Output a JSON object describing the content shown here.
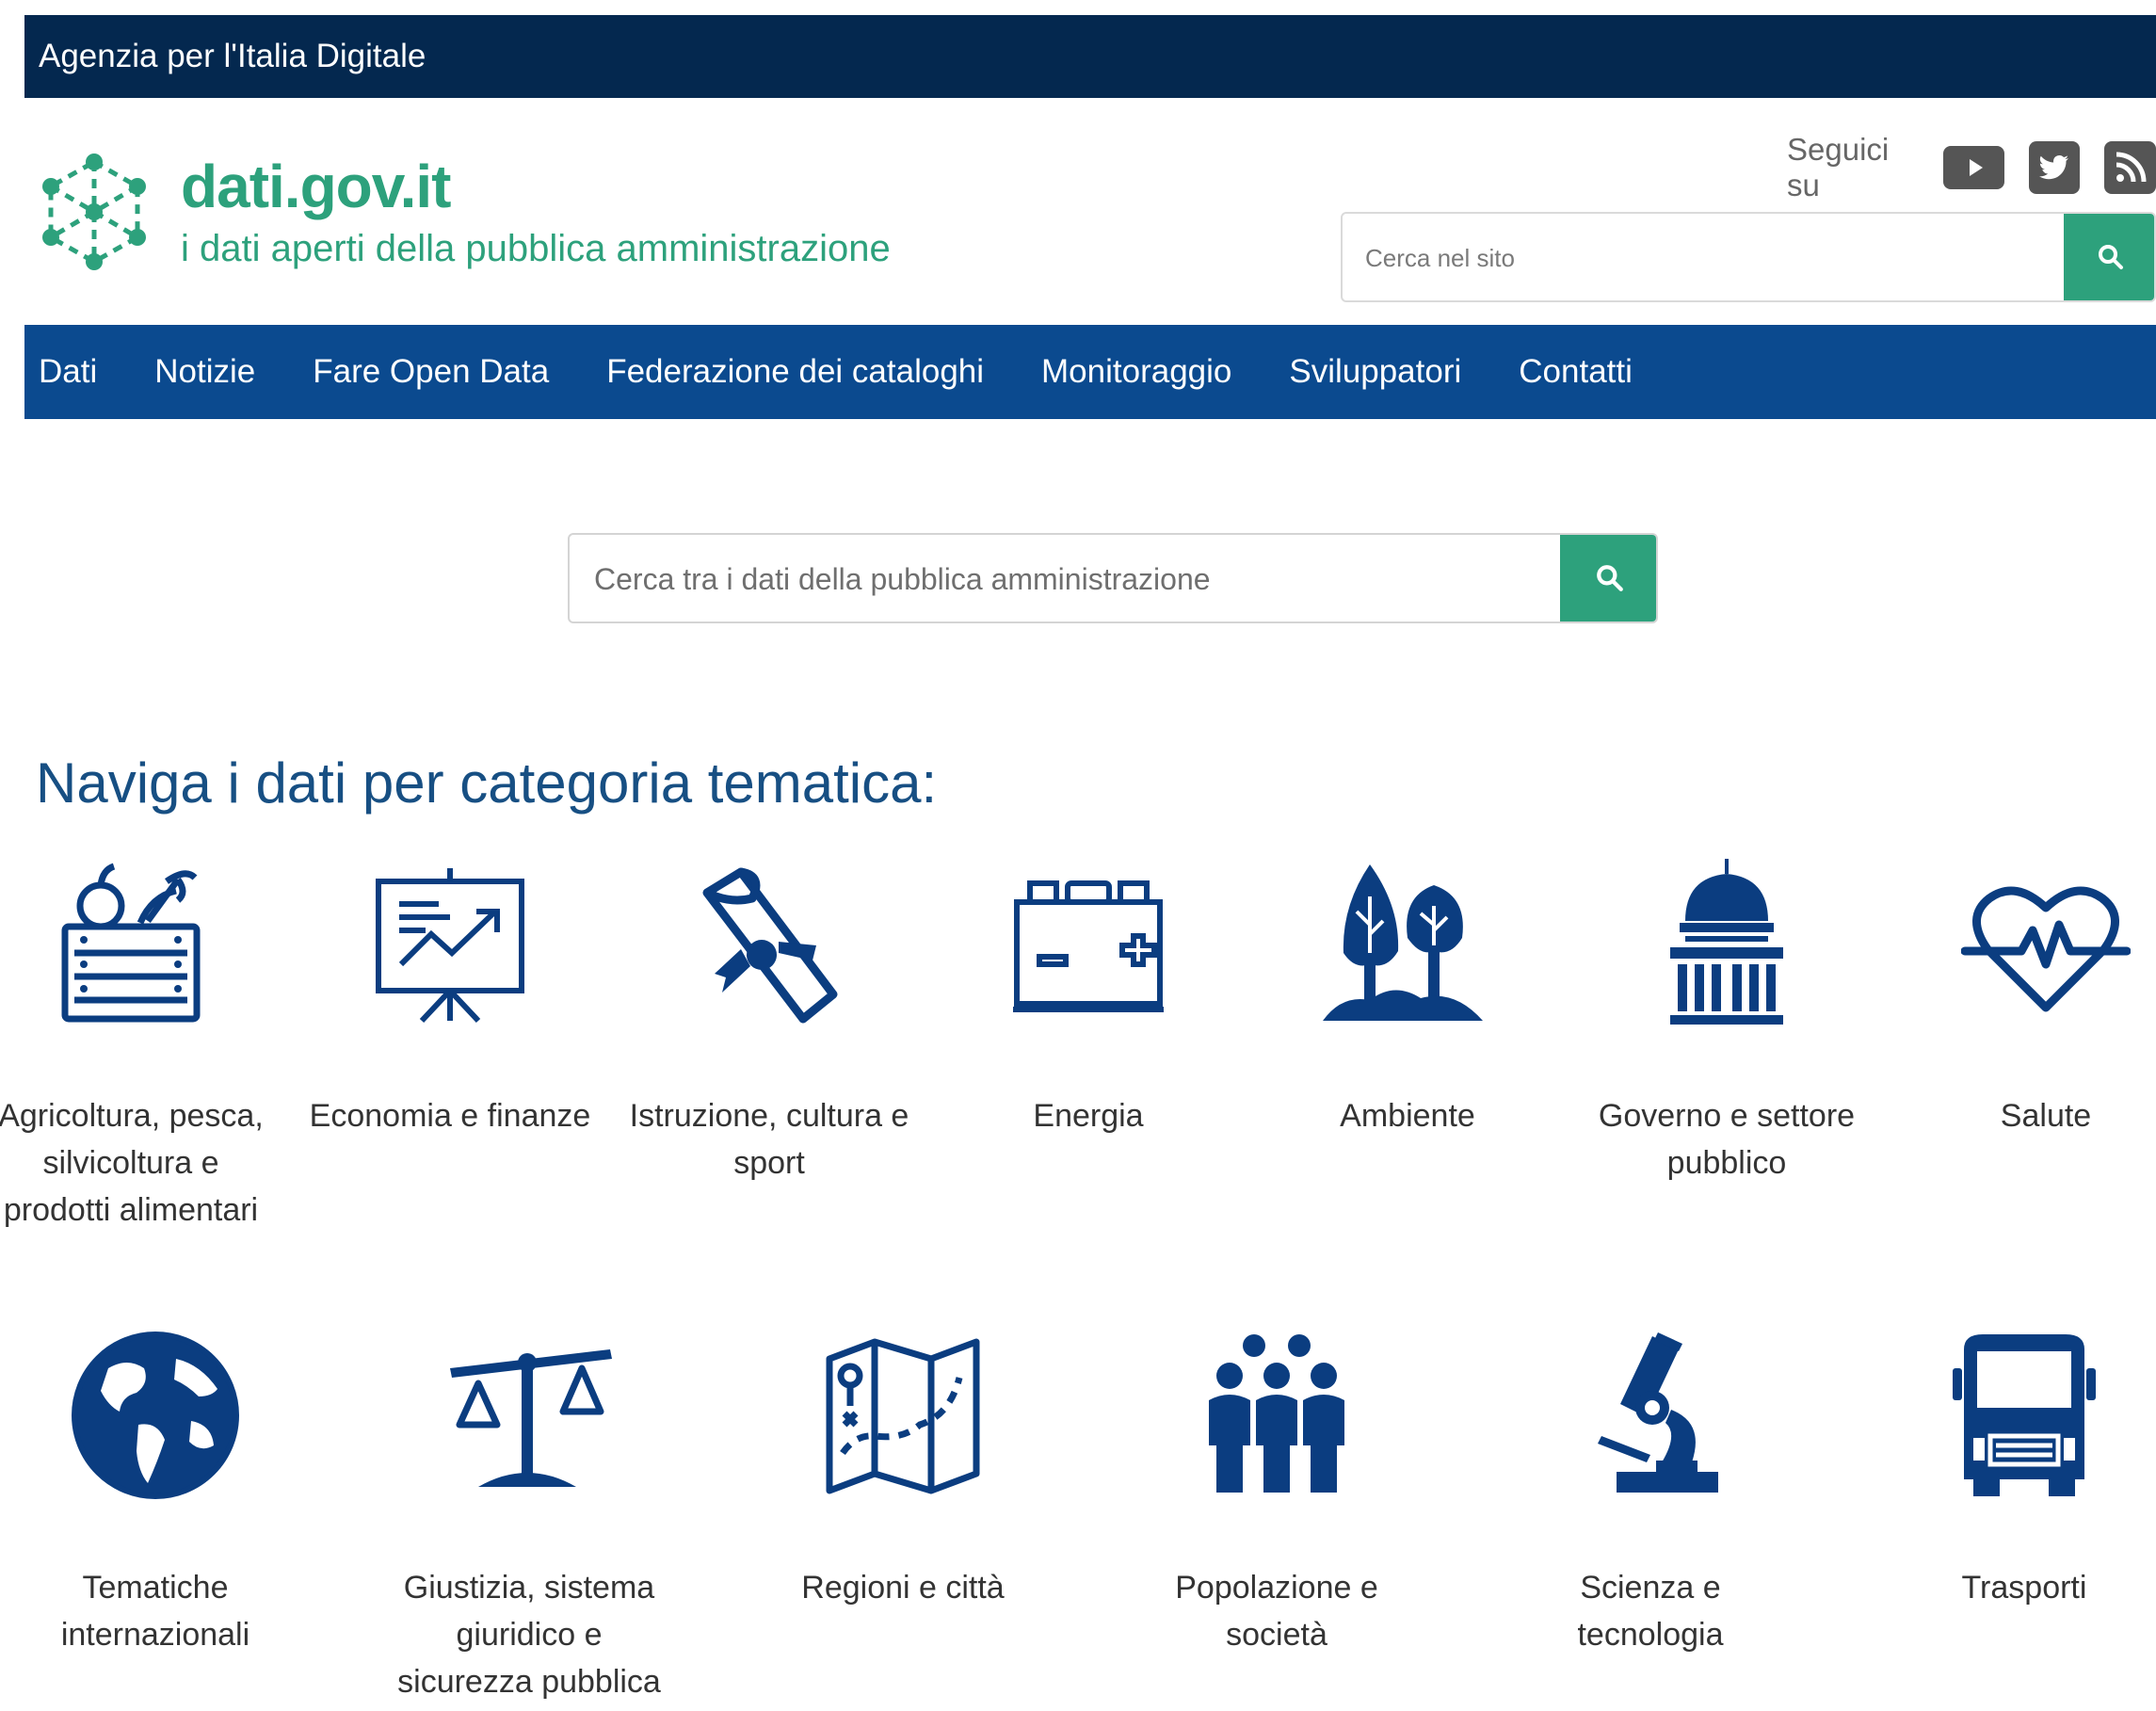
{
  "topbar": {
    "title": "Agenzia per l'Italia Digitale"
  },
  "brand": {
    "name": "dati.gov.it",
    "tagline": "i dati aperti della pubblica amministrazione",
    "color": "#2da17c"
  },
  "social": {
    "label": "Seguici su",
    "icons": [
      "youtube-icon",
      "twitter-icon",
      "rss-icon"
    ]
  },
  "site_search": {
    "placeholder": "Cerca nel sito"
  },
  "nav": {
    "items": [
      "Dati",
      "Notizie",
      "Fare Open Data",
      "Federazione dei cataloghi",
      "Monitoraggio",
      "Sviluppatori",
      "Contatti"
    ]
  },
  "main_search": {
    "placeholder": "Cerca tra i dati della pubblica amministrazione"
  },
  "section": {
    "title": "Naviga i dati per categoria tematica:"
  },
  "categories": [
    {
      "label": "Agricoltura, pesca, silvicoltura e prodotti alimentari",
      "icon": "agriculture-crate-icon"
    },
    {
      "label": "Economia e finanze",
      "icon": "presentation-chart-icon"
    },
    {
      "label": "Istruzione, cultura e sport",
      "icon": "diploma-scroll-icon"
    },
    {
      "label": "Energia",
      "icon": "battery-icon"
    },
    {
      "label": "Ambiente",
      "icon": "trees-icon"
    },
    {
      "label": "Governo e settore pubblico",
      "icon": "capitol-building-icon"
    },
    {
      "label": "Salute",
      "icon": "heartbeat-icon"
    },
    {
      "label": "Tematiche internazionali",
      "icon": "globe-icon"
    },
    {
      "label": "Giustizia, sistema giuridico e sicurezza pubblica",
      "icon": "scales-icon"
    },
    {
      "label": "Regioni e città",
      "icon": "map-icon"
    },
    {
      "label": "Popolazione e società",
      "icon": "people-group-icon"
    },
    {
      "label": "Scienza e tecnologia",
      "icon": "microscope-icon"
    },
    {
      "label": "Trasporti",
      "icon": "truck-icon"
    }
  ],
  "colors": {
    "topbar": "#04284f",
    "navbar": "#0b4a8f",
    "icons": "#0b3d80",
    "accent": "#2da17c",
    "title": "#174f83"
  }
}
